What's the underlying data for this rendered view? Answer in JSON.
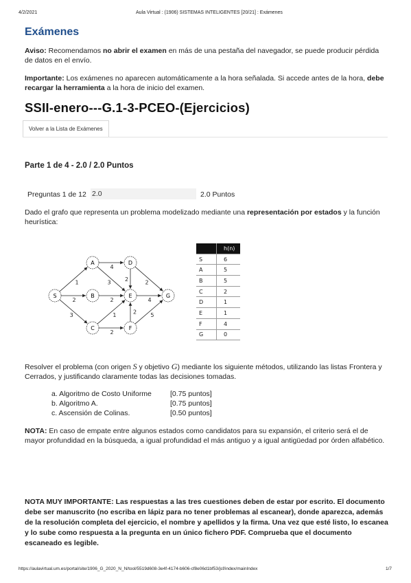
{
  "header": {
    "date": "4/2/2021",
    "title": "Aula Virtual : (1906) SISTEMAS INTELIGENTES [20/21] : Exámenes"
  },
  "section_title": "Exámenes",
  "aviso": {
    "label": "Aviso:",
    "text1": " Recomendamos ",
    "bold": "no abrir el examen",
    "text2": " en más de una pestaña del navegador, se puede producir pérdida de datos en el envío."
  },
  "importante": {
    "label": "Importante:",
    "text1": " Los exámenes no aparecen automáticamente a la hora señalada. Si accede antes de la hora, ",
    "bold": "debe recargar la herramienta",
    "text2": " a la hora de inicio del examen."
  },
  "exam_title": "SSII-enero---G.1-3-PCEO-(Ejercicios)",
  "back_tab": "Volver a la Lista de Exámenes",
  "part_title": "Parte 1 de 4 - 2.0 / 2.0 Puntos",
  "question": {
    "label": "Preguntas 1 de 12",
    "value": "2.0",
    "points": "2.0 Puntos"
  },
  "statement": {
    "text1": "Dado el grafo que representa un problema modelizado mediante una ",
    "bold": "representación por estados",
    "text2": " y la función heurística:"
  },
  "graph": {
    "nodes": [
      "S",
      "A",
      "B",
      "C",
      "D",
      "E",
      "F",
      "G"
    ],
    "edges": [
      {
        "from": "S",
        "to": "A",
        "cost": "1"
      },
      {
        "from": "S",
        "to": "B",
        "cost": "2"
      },
      {
        "from": "S",
        "to": "C",
        "cost": "3"
      },
      {
        "from": "A",
        "to": "D",
        "cost": "4"
      },
      {
        "from": "A",
        "to": "E",
        "cost": "3"
      },
      {
        "from": "B",
        "to": "E",
        "cost": "2"
      },
      {
        "from": "C",
        "to": "E",
        "cost": "1"
      },
      {
        "from": "C",
        "to": "F",
        "cost": "2"
      },
      {
        "from": "D",
        "to": "E",
        "cost": "2"
      },
      {
        "from": "D",
        "to": "G",
        "cost": "2"
      },
      {
        "from": "E",
        "to": "G",
        "cost": "4"
      },
      {
        "from": "F",
        "to": "E",
        "cost": "2"
      },
      {
        "from": "F",
        "to": "G",
        "cost": "5"
      }
    ]
  },
  "heuristic": {
    "header": "h(n)",
    "rows": [
      [
        "S",
        "6"
      ],
      [
        "A",
        "5"
      ],
      [
        "B",
        "5"
      ],
      [
        "C",
        "2"
      ],
      [
        "D",
        "1"
      ],
      [
        "E",
        "1"
      ],
      [
        "F",
        "4"
      ],
      [
        "G",
        "0"
      ]
    ]
  },
  "instructions": {
    "text1": "Resolver el problema (con origen ",
    "origin": "S",
    "text2": " y objetivo ",
    "goal": "G",
    "text3": ") mediante los siguiente métodos, utilizando las listas Frontera y Cerrados, y justificando claramente todas las decisiones tomadas."
  },
  "methods": [
    {
      "label": "a. Algoritmo de Costo Uniforme",
      "points": "[0.75 puntos]"
    },
    {
      "label": "b. Algoritmo A.",
      "points": "[0.75 puntos]"
    },
    {
      "label": "c. Ascensión de Colinas.",
      "points": "[0.50 puntos]"
    }
  ],
  "nota": {
    "label": "NOTA:",
    "text": " En caso de empate entre algunos estados como candidatos para su expansión, el criterio será el de mayor profundidad en la búsqueda, a igual profundidad el más antiguo y a igual antigüedad por órden alfabético."
  },
  "nota_importante": "NOTA MUY IMPORTANTE: Las respuestas a las tres cuestiones deben de estar por escrito. El documento debe ser manuscrito (no escriba en lápiz para no tener problemas al escanear), donde aparezca, además de la resolución completa del ejercicio, el nombre y apellidos y la firma. Una vez que esté listo, lo escanea y lo sube como respuesta a la pregunta en un único fichero PDF. Comprueba que el documento escaneado es legible.",
  "footer": {
    "url": "https://aulavirtual.um.es/portal/site/1906_G_2020_N_N/tool/5519d608-3e4f-4174-b606-cf8e06d1bf53/jsf/index/mainIndex",
    "page": "1/7"
  }
}
